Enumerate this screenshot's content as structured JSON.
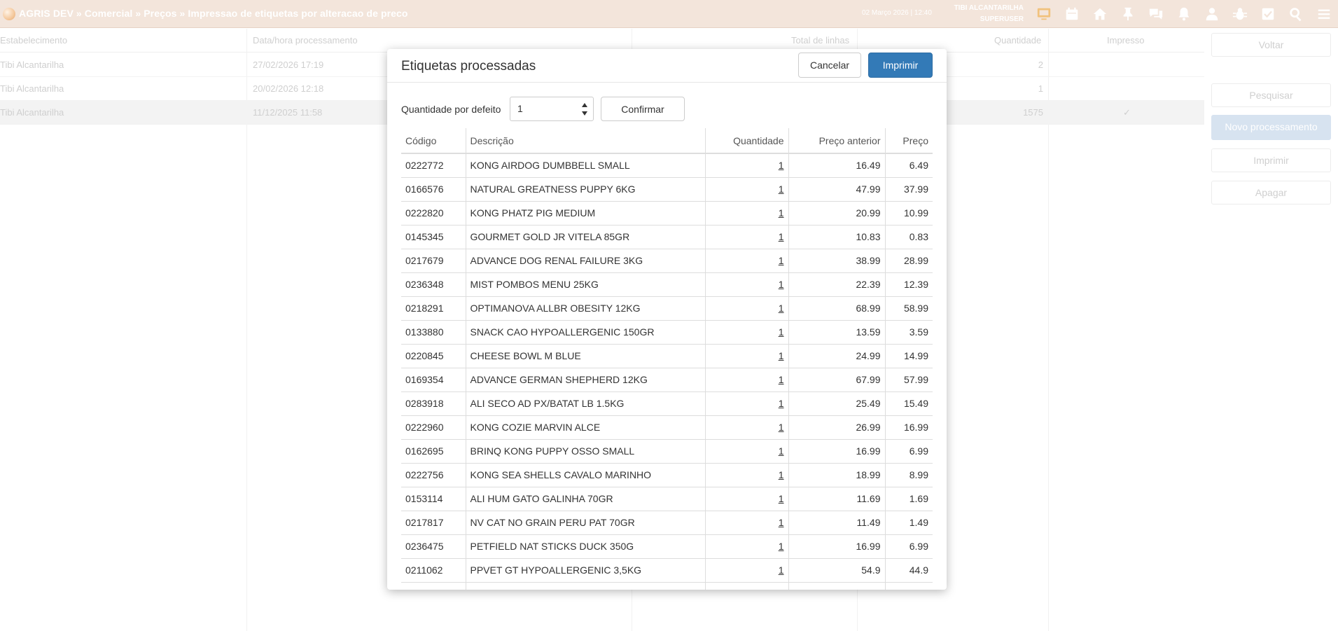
{
  "topbar": {
    "breadcrumb": "AGRIS DEV » Comercial » Preços » Impressao de etiquetas por alteracao de preco",
    "datetime": "02 Março 2026 | 12:40",
    "user_name": "TIBI ALCANTARILHA",
    "user_role": "SUPERUSER",
    "icons": [
      "monitor-icon",
      "calendar-icon",
      "home-icon",
      "pin-icon",
      "chat-icon",
      "bell-icon",
      "user-icon",
      "bug-icon",
      "checkbox-icon",
      "search-icon",
      "menu-icon"
    ]
  },
  "background": {
    "columns": [
      "Estabelecimento",
      "Data/hora processamento",
      "Total de linhas",
      "Quantidade",
      "Impresso"
    ],
    "rows": [
      {
        "estabelecimento": "Tibi Alcantarilha",
        "data": "27/02/2026 17:19",
        "quantidade": "2",
        "impresso": ""
      },
      {
        "estabelecimento": "Tibi Alcantarilha",
        "data": "20/02/2026 12:18",
        "quantidade": "1",
        "impresso": ""
      },
      {
        "estabelecimento": "Tibi Alcantarilha",
        "data": "11/12/2025 11:58",
        "quantidade": "1575",
        "impresso": "✓"
      }
    ],
    "side_buttons": {
      "voltar": "Voltar",
      "pesquisar": "Pesquisar",
      "novo": "Novo processamento",
      "imprimir": "Imprimir",
      "apagar": "Apagar"
    }
  },
  "modal": {
    "title": "Etiquetas processadas",
    "cancel_label": "Cancelar",
    "print_label": "Imprimir",
    "default_qty_label": "Quantidade por defeito",
    "default_qty_value": "1",
    "confirm_label": "Confirmar",
    "columns": {
      "codigo": "Código",
      "descricao": "Descrição",
      "quantidade": "Quantidade",
      "preco_anterior": "Preço anterior",
      "preco": "Preço"
    },
    "rows": [
      {
        "codigo": "0222772",
        "descricao": "KONG AIRDOG DUMBBELL SMALL",
        "quantidade": "1",
        "preco_anterior": "16.49",
        "preco": "6.49"
      },
      {
        "codigo": "0166576",
        "descricao": "NATURAL GREATNESS PUPPY 6KG",
        "quantidade": "1",
        "preco_anterior": "47.99",
        "preco": "37.99"
      },
      {
        "codigo": "0222820",
        "descricao": "KONG PHATZ PIG MEDIUM",
        "quantidade": "1",
        "preco_anterior": "20.99",
        "preco": "10.99"
      },
      {
        "codigo": "0145345",
        "descricao": "GOURMET GOLD JR VITELA 85GR",
        "quantidade": "1",
        "preco_anterior": "10.83",
        "preco": "0.83"
      },
      {
        "codigo": "0217679",
        "descricao": "ADVANCE DOG RENAL FAILURE 3KG",
        "quantidade": "1",
        "preco_anterior": "38.99",
        "preco": "28.99"
      },
      {
        "codigo": "0236348",
        "descricao": "MIST POMBOS MENU 25KG",
        "quantidade": "1",
        "preco_anterior": "22.39",
        "preco": "12.39"
      },
      {
        "codigo": "0218291",
        "descricao": "OPTIMANOVA ALLBR OBESITY 12KG",
        "quantidade": "1",
        "preco_anterior": "68.99",
        "preco": "58.99"
      },
      {
        "codigo": "0133880",
        "descricao": "SNACK CAO HYPOALLERGENIC 150GR",
        "quantidade": "1",
        "preco_anterior": "13.59",
        "preco": "3.59"
      },
      {
        "codigo": "0220845",
        "descricao": "CHEESE BOWL M BLUE",
        "quantidade": "1",
        "preco_anterior": "24.99",
        "preco": "14.99"
      },
      {
        "codigo": "0169354",
        "descricao": "ADVANCE GERMAN SHEPHERD 12KG",
        "quantidade": "1",
        "preco_anterior": "67.99",
        "preco": "57.99"
      },
      {
        "codigo": "0283918",
        "descricao": "ALI SECO AD PX/BATAT LB 1.5KG",
        "quantidade": "1",
        "preco_anterior": "25.49",
        "preco": "15.49"
      },
      {
        "codigo": "0222960",
        "descricao": "KONG COZIE MARVIN ALCE",
        "quantidade": "1",
        "preco_anterior": "26.99",
        "preco": "16.99"
      },
      {
        "codigo": "0162695",
        "descricao": "BRINQ KONG PUPPY OSSO SMALL",
        "quantidade": "1",
        "preco_anterior": "16.99",
        "preco": "6.99"
      },
      {
        "codigo": "0222756",
        "descricao": "KONG SEA SHELLS CAVALO MARINHO",
        "quantidade": "1",
        "preco_anterior": "18.99",
        "preco": "8.99"
      },
      {
        "codigo": "0153114",
        "descricao": "ALI HUM GATO GALINHA 70GR",
        "quantidade": "1",
        "preco_anterior": "11.69",
        "preco": "1.69"
      },
      {
        "codigo": "0217817",
        "descricao": "NV CAT NO GRAIN PERU PAT 70GR",
        "quantidade": "1",
        "preco_anterior": "11.49",
        "preco": "1.49"
      },
      {
        "codigo": "0236475",
        "descricao": "PETFIELD NAT STICKS DUCK 350G",
        "quantidade": "1",
        "preco_anterior": "16.99",
        "preco": "6.99"
      },
      {
        "codigo": "0211062",
        "descricao": "PPVET GT HYPOALLERGENIC 3,5KG",
        "quantidade": "1",
        "preco_anterior": "54.9",
        "preco": "44.9"
      },
      {
        "codigo": "",
        "descricao": "",
        "quantidade": "",
        "preco_anterior": "",
        "preco": ""
      }
    ]
  }
}
